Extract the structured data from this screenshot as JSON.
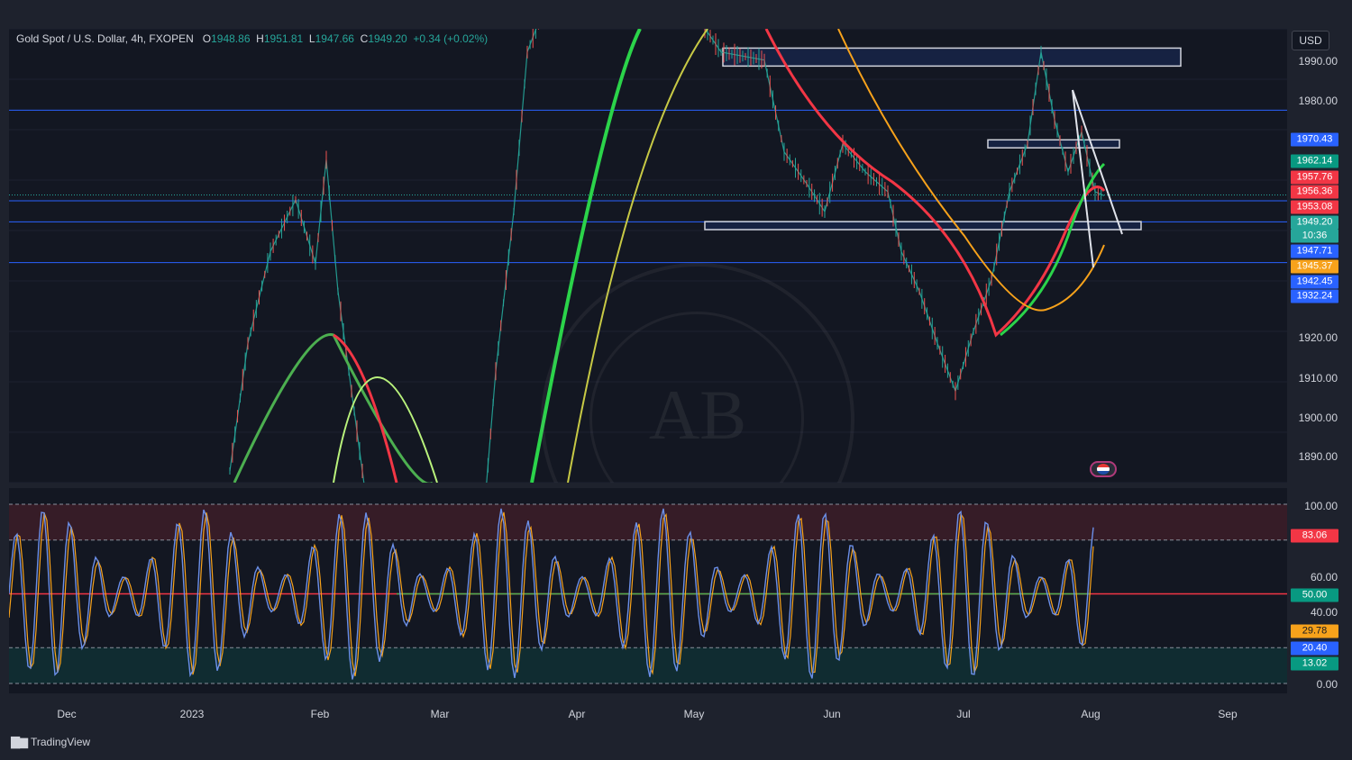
{
  "header": {
    "symbol": "Gold Spot / U.S. Dollar, 4h, FXOPEN",
    "open_label": "O",
    "open": "1948.86",
    "high_label": "H",
    "high": "1951.81",
    "low_label": "L",
    "low": "1947.66",
    "close_label": "C",
    "close": "1949.20",
    "change": "+0.34 (+0.02%)"
  },
  "currency": "USD",
  "watermark_text": "AB",
  "branding": {
    "logo": "TradingView"
  },
  "time_axis": [
    "Dec",
    "2023",
    "Feb",
    "Mar",
    "Apr",
    "May",
    "Jun",
    "Jul",
    "Aug",
    "Sep"
  ],
  "price_ticks": [
    "1990.00",
    "1980.00",
    "1920.00",
    "1910.00",
    "1900.00",
    "1890.00"
  ],
  "osc_ticks": [
    "100.00",
    "60.00",
    "40.00",
    "0.00"
  ],
  "price_tags": [
    {
      "text": "1970.43",
      "color": "#2962ff"
    },
    {
      "text": "1962.14",
      "color": "#089981"
    },
    {
      "text": "1957.76",
      "color": "#f23645"
    },
    {
      "text": "1956.36",
      "color": "#f23645"
    },
    {
      "text": "1953.08",
      "color": "#f23645"
    },
    {
      "text": "1949.20",
      "color": "#26a69a"
    },
    {
      "text": "10:36",
      "color": "#26a69a"
    },
    {
      "text": "1947.71",
      "color": "#2962ff"
    },
    {
      "text": "1945.37",
      "color": "#f7a21b"
    },
    {
      "text": "1942.45",
      "color": "#2962ff"
    },
    {
      "text": "1932.24",
      "color": "#2962ff"
    }
  ],
  "osc_tags": [
    {
      "text": "83.06",
      "color": "#f23645"
    },
    {
      "text": "50.00",
      "color": "#089981"
    },
    {
      "text": "29.78",
      "color": "#f7a21b"
    },
    {
      "text": "20.40",
      "color": "#2962ff"
    },
    {
      "text": "13.02",
      "color": "#089981"
    }
  ],
  "horizontal_levels": [
    1970.43,
    1947.71,
    1942.45,
    1932.24
  ],
  "zones": [
    {
      "from": 1981.5,
      "to": 1986.0
    },
    {
      "from": 1961.0,
      "to": 1963.0
    },
    {
      "from": 1940.5,
      "to": 1942.5
    }
  ],
  "osc_levels": {
    "upper": 80,
    "middle": 50,
    "lower": 20
  },
  "colors": {
    "bg": "#131722",
    "grid": "#1e222d",
    "up": "#26a69a",
    "down": "#ef5350",
    "level": "#2962ff"
  }
}
